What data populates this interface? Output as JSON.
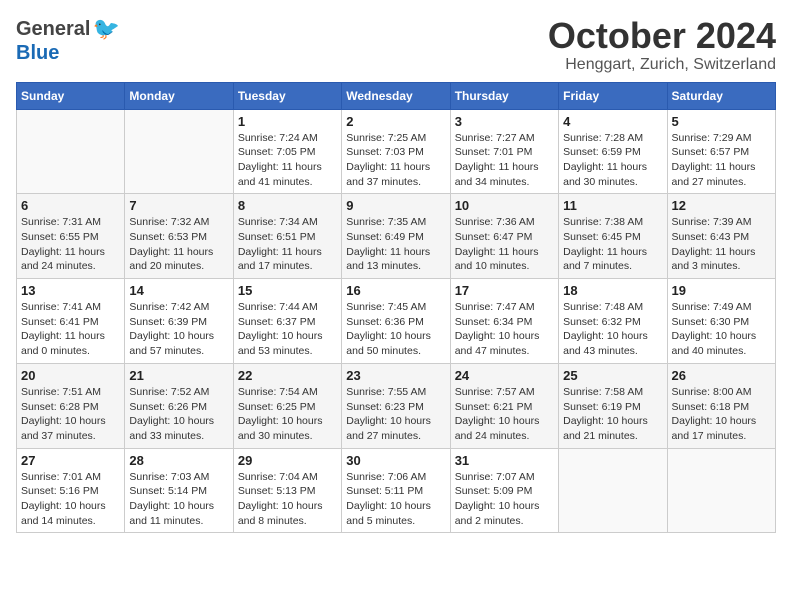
{
  "header": {
    "logo_general": "General",
    "logo_blue": "Blue",
    "month": "October 2024",
    "location": "Henggart, Zurich, Switzerland"
  },
  "weekdays": [
    "Sunday",
    "Monday",
    "Tuesday",
    "Wednesday",
    "Thursday",
    "Friday",
    "Saturday"
  ],
  "weeks": [
    [
      {
        "day": "",
        "info": ""
      },
      {
        "day": "",
        "info": ""
      },
      {
        "day": "1",
        "info": "Sunrise: 7:24 AM\nSunset: 7:05 PM\nDaylight: 11 hours and 41 minutes."
      },
      {
        "day": "2",
        "info": "Sunrise: 7:25 AM\nSunset: 7:03 PM\nDaylight: 11 hours and 37 minutes."
      },
      {
        "day": "3",
        "info": "Sunrise: 7:27 AM\nSunset: 7:01 PM\nDaylight: 11 hours and 34 minutes."
      },
      {
        "day": "4",
        "info": "Sunrise: 7:28 AM\nSunset: 6:59 PM\nDaylight: 11 hours and 30 minutes."
      },
      {
        "day": "5",
        "info": "Sunrise: 7:29 AM\nSunset: 6:57 PM\nDaylight: 11 hours and 27 minutes."
      }
    ],
    [
      {
        "day": "6",
        "info": "Sunrise: 7:31 AM\nSunset: 6:55 PM\nDaylight: 11 hours and 24 minutes."
      },
      {
        "day": "7",
        "info": "Sunrise: 7:32 AM\nSunset: 6:53 PM\nDaylight: 11 hours and 20 minutes."
      },
      {
        "day": "8",
        "info": "Sunrise: 7:34 AM\nSunset: 6:51 PM\nDaylight: 11 hours and 17 minutes."
      },
      {
        "day": "9",
        "info": "Sunrise: 7:35 AM\nSunset: 6:49 PM\nDaylight: 11 hours and 13 minutes."
      },
      {
        "day": "10",
        "info": "Sunrise: 7:36 AM\nSunset: 6:47 PM\nDaylight: 11 hours and 10 minutes."
      },
      {
        "day": "11",
        "info": "Sunrise: 7:38 AM\nSunset: 6:45 PM\nDaylight: 11 hours and 7 minutes."
      },
      {
        "day": "12",
        "info": "Sunrise: 7:39 AM\nSunset: 6:43 PM\nDaylight: 11 hours and 3 minutes."
      }
    ],
    [
      {
        "day": "13",
        "info": "Sunrise: 7:41 AM\nSunset: 6:41 PM\nDaylight: 11 hours and 0 minutes."
      },
      {
        "day": "14",
        "info": "Sunrise: 7:42 AM\nSunset: 6:39 PM\nDaylight: 10 hours and 57 minutes."
      },
      {
        "day": "15",
        "info": "Sunrise: 7:44 AM\nSunset: 6:37 PM\nDaylight: 10 hours and 53 minutes."
      },
      {
        "day": "16",
        "info": "Sunrise: 7:45 AM\nSunset: 6:36 PM\nDaylight: 10 hours and 50 minutes."
      },
      {
        "day": "17",
        "info": "Sunrise: 7:47 AM\nSunset: 6:34 PM\nDaylight: 10 hours and 47 minutes."
      },
      {
        "day": "18",
        "info": "Sunrise: 7:48 AM\nSunset: 6:32 PM\nDaylight: 10 hours and 43 minutes."
      },
      {
        "day": "19",
        "info": "Sunrise: 7:49 AM\nSunset: 6:30 PM\nDaylight: 10 hours and 40 minutes."
      }
    ],
    [
      {
        "day": "20",
        "info": "Sunrise: 7:51 AM\nSunset: 6:28 PM\nDaylight: 10 hours and 37 minutes."
      },
      {
        "day": "21",
        "info": "Sunrise: 7:52 AM\nSunset: 6:26 PM\nDaylight: 10 hours and 33 minutes."
      },
      {
        "day": "22",
        "info": "Sunrise: 7:54 AM\nSunset: 6:25 PM\nDaylight: 10 hours and 30 minutes."
      },
      {
        "day": "23",
        "info": "Sunrise: 7:55 AM\nSunset: 6:23 PM\nDaylight: 10 hours and 27 minutes."
      },
      {
        "day": "24",
        "info": "Sunrise: 7:57 AM\nSunset: 6:21 PM\nDaylight: 10 hours and 24 minutes."
      },
      {
        "day": "25",
        "info": "Sunrise: 7:58 AM\nSunset: 6:19 PM\nDaylight: 10 hours and 21 minutes."
      },
      {
        "day": "26",
        "info": "Sunrise: 8:00 AM\nSunset: 6:18 PM\nDaylight: 10 hours and 17 minutes."
      }
    ],
    [
      {
        "day": "27",
        "info": "Sunrise: 7:01 AM\nSunset: 5:16 PM\nDaylight: 10 hours and 14 minutes."
      },
      {
        "day": "28",
        "info": "Sunrise: 7:03 AM\nSunset: 5:14 PM\nDaylight: 10 hours and 11 minutes."
      },
      {
        "day": "29",
        "info": "Sunrise: 7:04 AM\nSunset: 5:13 PM\nDaylight: 10 hours and 8 minutes."
      },
      {
        "day": "30",
        "info": "Sunrise: 7:06 AM\nSunset: 5:11 PM\nDaylight: 10 hours and 5 minutes."
      },
      {
        "day": "31",
        "info": "Sunrise: 7:07 AM\nSunset: 5:09 PM\nDaylight: 10 hours and 2 minutes."
      },
      {
        "day": "",
        "info": ""
      },
      {
        "day": "",
        "info": ""
      }
    ]
  ]
}
